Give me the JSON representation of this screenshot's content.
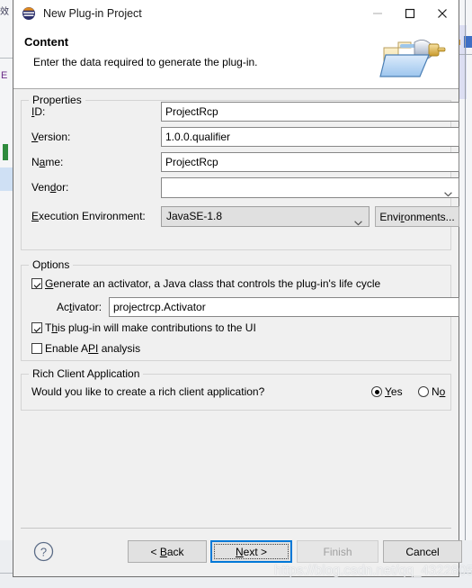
{
  "window": {
    "title": "New Plug-in Project",
    "icon": "eclipse-icon",
    "minimize_label": "Minimize",
    "maximize_label": "Maximize",
    "close_label": "Close"
  },
  "header": {
    "title": "Content",
    "description": "Enter the data required to generate the plug-in.",
    "banner_icon": "plugin-folder-icon"
  },
  "properties": {
    "group_title": "Properties",
    "fields": [
      {
        "label": "ID:",
        "mnemonic": "I",
        "value": "ProjectRcp"
      },
      {
        "label": "Version:",
        "mnemonic": "V",
        "value": "1.0.0.qualifier"
      },
      {
        "label": "Name:",
        "mnemonic": "a",
        "value": "ProjectRcp"
      },
      {
        "label": "Vendor:",
        "mnemonic": "d",
        "value": ""
      }
    ],
    "execution_environment": {
      "label": "Execution Environment:",
      "mnemonic": "E",
      "value": "JavaSE-1.8",
      "button_label": "Environments..."
    }
  },
  "options": {
    "group_title": "Options",
    "generate_activator": {
      "label": "Generate an activator, a Java class that controls the plug-in's life cycle",
      "checked": true
    },
    "activator": {
      "label": "Activator:",
      "value": "projectrcp.Activator"
    },
    "ui_contributions": {
      "label": "This plug-in will make contributions to the UI",
      "checked": true
    },
    "api_analysis": {
      "label": "Enable API analysis",
      "checked": false
    }
  },
  "rich_client": {
    "group_title": "Rich Client Application",
    "question": "Would you like to create a rich client application?",
    "yes_label": "Yes",
    "no_label": "No",
    "selected": "Yes"
  },
  "footer": {
    "help_label": "?",
    "back_label": "< Back",
    "next_label": "Next >",
    "finish_label": "Finish",
    "cancel_label": "Cancel",
    "finish_disabled": true,
    "focused_button": "Next >"
  },
  "watermark": {
    "text": "https://blog.csdn.net/qq_43228058"
  },
  "colors": {
    "dialog_bg": "#f0f0f0",
    "header_bg": "#ffffff",
    "focus_blue": "#0078d7",
    "border": "#878787"
  },
  "background": {
    "left_text": "效",
    "left_letter": "E",
    "plus_icon": "plus-icon"
  }
}
